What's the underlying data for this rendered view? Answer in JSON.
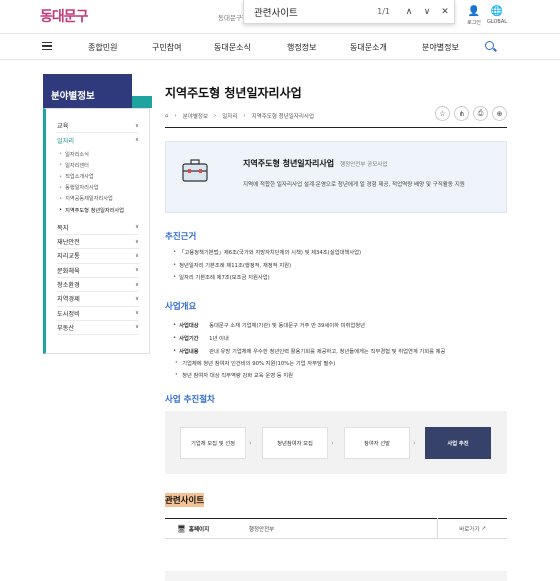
{
  "find_bar": {
    "query": "관련사이트",
    "count": "1/1"
  },
  "header": {
    "logo": "동대문구",
    "site_name": "동대문구청",
    "login": "로그인",
    "global": "GLOBAL"
  },
  "nav": {
    "items": [
      "종합민원",
      "구민참여",
      "동대문소식",
      "행정정보",
      "동대문소개",
      "분야별정보"
    ]
  },
  "sidebar": {
    "title": "분야별정보",
    "items": [
      {
        "label": "교육"
      },
      {
        "label": "일자리",
        "active": true
      },
      {
        "label": "복지"
      },
      {
        "label": "재난안전"
      },
      {
        "label": "지리교통"
      },
      {
        "label": "문화체육"
      },
      {
        "label": "청소환경"
      },
      {
        "label": "지역경제"
      },
      {
        "label": "도시정비"
      },
      {
        "label": "부동산"
      }
    ],
    "sub_items": [
      "일자리소식",
      "일자리센터",
      "직업소개사업",
      "동행일자리사업",
      "지역공동체일자리사업",
      "지역주도형 청년일자리사업"
    ]
  },
  "page": {
    "title": "지역주도형 청년일자리사업",
    "breadcrumbs": [
      "분야별정보",
      "일자리",
      "지역주도형 청년일자리사업"
    ]
  },
  "info_card": {
    "title": "지역주도형 청년일자리사업",
    "org": "행정안전부 공모사업",
    "desc": "지역에 적합한 일자리사업 설계·운영으로 청년에게 일 경험 제공, 적업역량 배양 및 구직활동 지원"
  },
  "basis": {
    "heading": "추진근거",
    "items": [
      "「고용정책기본법」제6조(국가와 지방자치단체의 시책) 및 제34조(실업대책사업)",
      "청년일자리 기본조례 제11조(행정적, 재정적 지원)",
      "일자리 기본조례 제7조(보조금 지원사업)"
    ]
  },
  "overview": {
    "heading": "사업개요",
    "rows": [
      {
        "label": "사업대상",
        "value": "동대문구 소재 기업체(기관) 및 동대문구 거주 만 39세이하 미취업청년"
      },
      {
        "label": "사업기간",
        "value": "1년 이내"
      },
      {
        "label": "사업내용",
        "value": "관내 유망 기업체에 우수한 청년인력 활용기회를 제공하고, 청년들에게는 직무경험 및 취업연계 기회를 제공"
      }
    ],
    "subs": [
      "기업체에 청년 참여자 인건비의 90% 지원(10%는 기업 자부담 필수)",
      "청년 참여자 대상 직무역량 강화 교육 운영 등 지원"
    ]
  },
  "procedure": {
    "heading": "사업 추진절차",
    "steps": [
      "기업체 모집 및 선정",
      "청년참여자 모집",
      "참여자 선발",
      "사업 추진"
    ]
  },
  "related": {
    "heading": "관련사이트",
    "rows": [
      {
        "type": "홈페이지",
        "name": "행정안전부",
        "link": "바로가기"
      }
    ]
  }
}
